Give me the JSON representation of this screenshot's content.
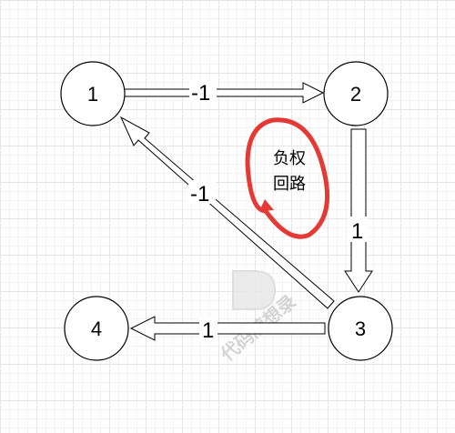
{
  "nodes": [
    {
      "id": "1",
      "label": "1"
    },
    {
      "id": "2",
      "label": "2"
    },
    {
      "id": "3",
      "label": "3"
    },
    {
      "id": "4",
      "label": "4"
    }
  ],
  "edges": [
    {
      "from": "1",
      "to": "2",
      "weight": "-1"
    },
    {
      "from": "2",
      "to": "3",
      "weight": "1"
    },
    {
      "from": "3",
      "to": "1",
      "weight": "-1"
    },
    {
      "from": "3",
      "to": "4",
      "weight": "1"
    }
  ],
  "annotation": {
    "line1": "负权",
    "line2": "回路",
    "color": "#e53935"
  },
  "watermark": {
    "text": "代码随想录"
  }
}
